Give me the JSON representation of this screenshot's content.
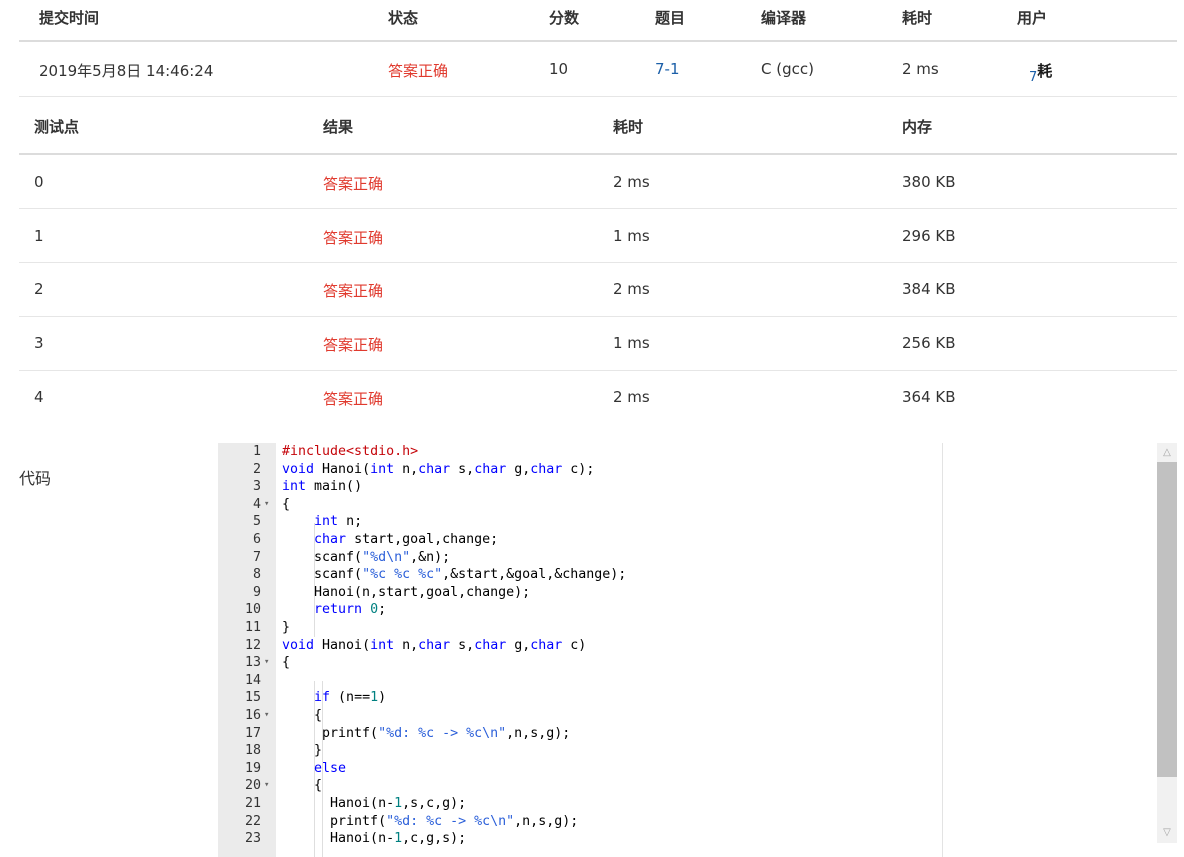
{
  "submission": {
    "headers": [
      "提交时间",
      "状态",
      "分数",
      "题目",
      "编译器",
      "耗时",
      "用户"
    ],
    "time": "2019年5月8日 14:46:24",
    "status": "答案正确",
    "score": "10",
    "problem": "7-1",
    "compiler": "C (gcc)",
    "duration": "2 ms",
    "user_num": "7",
    "user_text": "耗"
  },
  "testcases": {
    "headers": [
      "测试点",
      "结果",
      "耗时",
      "内存"
    ],
    "rows": [
      {
        "id": "0",
        "result": "答案正确",
        "time": "2 ms",
        "memory": "380 KB"
      },
      {
        "id": "1",
        "result": "答案正确",
        "time": "1 ms",
        "memory": "296 KB"
      },
      {
        "id": "2",
        "result": "答案正确",
        "time": "2 ms",
        "memory": "384 KB"
      },
      {
        "id": "3",
        "result": "答案正确",
        "time": "1 ms",
        "memory": "256 KB"
      },
      {
        "id": "4",
        "result": "答案正确",
        "time": "2 ms",
        "memory": "364 KB"
      }
    ]
  },
  "code_label": "代码",
  "code_lines": [
    "#include<stdio.h>",
    "void Hanoi(int n,char s,char g,char c);",
    "int main()",
    "{",
    "    int n;",
    "    char start,goal,change;",
    "    scanf(\"%d\\n\",&n);",
    "    scanf(\"%c %c %c\",&start,&goal,&change);",
    "    Hanoi(n,start,goal,change);",
    "    return 0;",
    "}",
    "void Hanoi(int n,char s,char g,char c)",
    "{",
    "",
    "    if (n==1)",
    "    {",
    "     printf(\"%d: %c -> %c\\n\",n,s,g);",
    "    }",
    "    else",
    "    {",
    "      Hanoi(n-1,s,c,g);",
    "      printf(\"%d: %c -> %c\\n\",n,s,g);",
    "      Hanoi(n-1,c,g,s);"
  ],
  "fold_lines": [
    4,
    13,
    16,
    20
  ],
  "icons": {
    "fold": "fold-arrow-icon",
    "scroll_up": "scroll-up-icon",
    "scroll_down": "scroll-down-icon"
  },
  "colors": {
    "accepted": "#e03a2e",
    "link": "#1b5fa8",
    "keyword": "#0000ff",
    "string": "#2b5fd9",
    "number": "#008080",
    "preprocessor": "#c5060b"
  }
}
